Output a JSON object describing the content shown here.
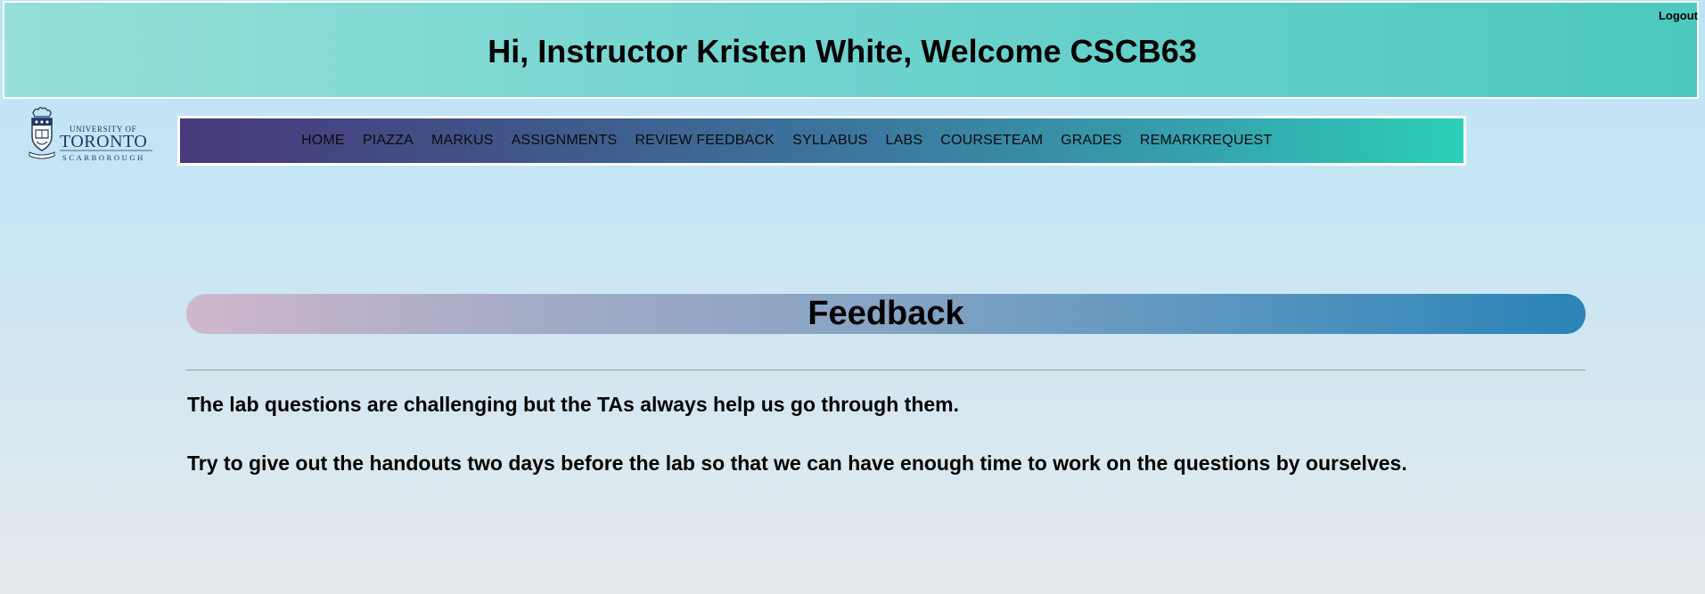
{
  "header": {
    "welcome_text": "Hi, Instructor Kristen White, Welcome CSCB63",
    "logout_label": "Logout"
  },
  "logo": {
    "line1": "UNIVERSITY OF",
    "line2": "TORONTO",
    "line3": "SCARBOROUGH"
  },
  "nav": {
    "items": [
      {
        "label": "HOME"
      },
      {
        "label": "PIAZZA"
      },
      {
        "label": "MARKUS"
      },
      {
        "label": "ASSIGNMENTS"
      },
      {
        "label": "REVIEW FEEDBACK"
      },
      {
        "label": "SYLLABUS"
      },
      {
        "label": "LABS"
      },
      {
        "label": "COURSETEAM"
      },
      {
        "label": "GRADES"
      },
      {
        "label": "REMARKREQUEST"
      }
    ]
  },
  "main": {
    "section_title": "Feedback",
    "comments": [
      {
        "text": "The lab questions are challenging but the TAs always help us go through them."
      },
      {
        "text": "Try to give out the handouts two days before the lab so that we can have enough time to work on the questions by ourselves."
      }
    ]
  },
  "colors": {
    "header_start": "#97dfd9",
    "header_end": "#4dc9c0",
    "nav_start": "#47397a",
    "nav_end": "#2ccfb8",
    "banner_start": "#d0b7cd",
    "banner_end": "#2a83b8",
    "logo_navy": "#1f3864"
  }
}
